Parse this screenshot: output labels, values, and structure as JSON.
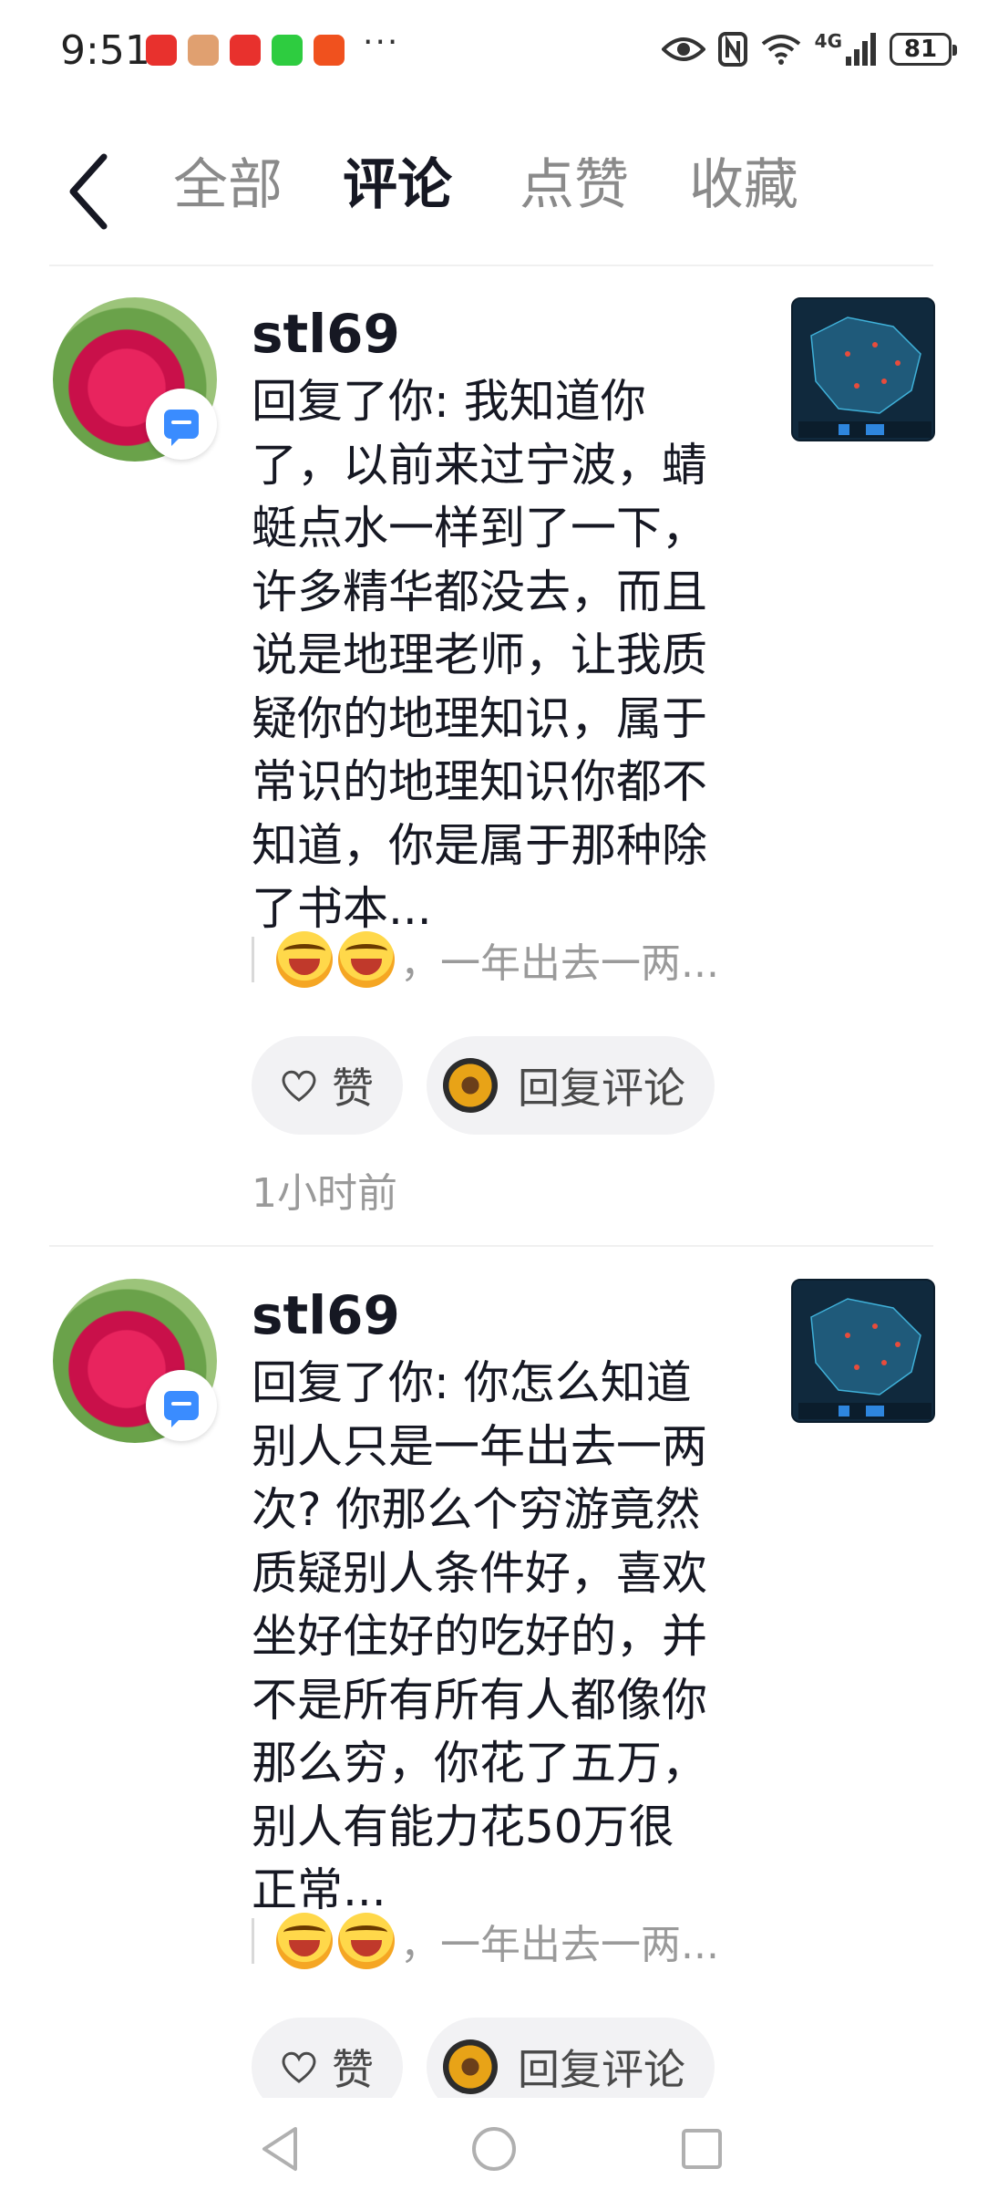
{
  "status_bar": {
    "time": "9:51",
    "overflow_indicator": "···",
    "battery": "81",
    "network": "4G",
    "app_icons": [
      {
        "name": "huawei-store-icon",
        "color": "#e8312d"
      },
      {
        "name": "user-avatar-icon",
        "color": "#e0a070"
      },
      {
        "name": "huawei-app-icon",
        "color": "#e8312d"
      },
      {
        "name": "wechat-icon",
        "color": "#2ecc40"
      },
      {
        "name": "orange-app-icon",
        "color": "#f0511e"
      }
    ]
  },
  "header": {
    "tabs": [
      {
        "label": "全部",
        "active": false
      },
      {
        "label": "评论",
        "active": true
      },
      {
        "label": "点赞",
        "active": false
      },
      {
        "label": "收藏",
        "active": false
      }
    ]
  },
  "comments": [
    {
      "username": "stl69",
      "lines": [
        "回复了你: 我知道你",
        "了，以前来过宁波，蜻",
        "蜓点水一样到了一下，",
        "许多精华都没去，而且",
        "说是地理老师，让我质",
        "疑你的地理知识，属于",
        "常识的地理知识你都不",
        "知道，你是属于那种除",
        "了书本..."
      ],
      "quote": "，一年出去一两...",
      "like_label": "赞",
      "reply_label": "回复评论",
      "time": "1小时前"
    },
    {
      "username": "stl69",
      "lines": [
        "回复了你: 你怎么知道",
        "别人只是一年出去一两",
        "次? 你那么个穷游竟然",
        "质疑别人条件好，喜欢",
        "坐好住好的吃好的，并",
        "不是所有所有人都像你",
        "那么穷，你花了五万，",
        "别人有能力花50万很",
        "正常..."
      ],
      "quote": "，一年出去一两...",
      "like_label": "赞",
      "reply_label": "回复评论"
    }
  ],
  "colors": {
    "accent_blue": "#3a8cff",
    "text_primary": "#161823",
    "text_secondary": "#9a9a9a",
    "button_bg": "#f2f2f4"
  }
}
